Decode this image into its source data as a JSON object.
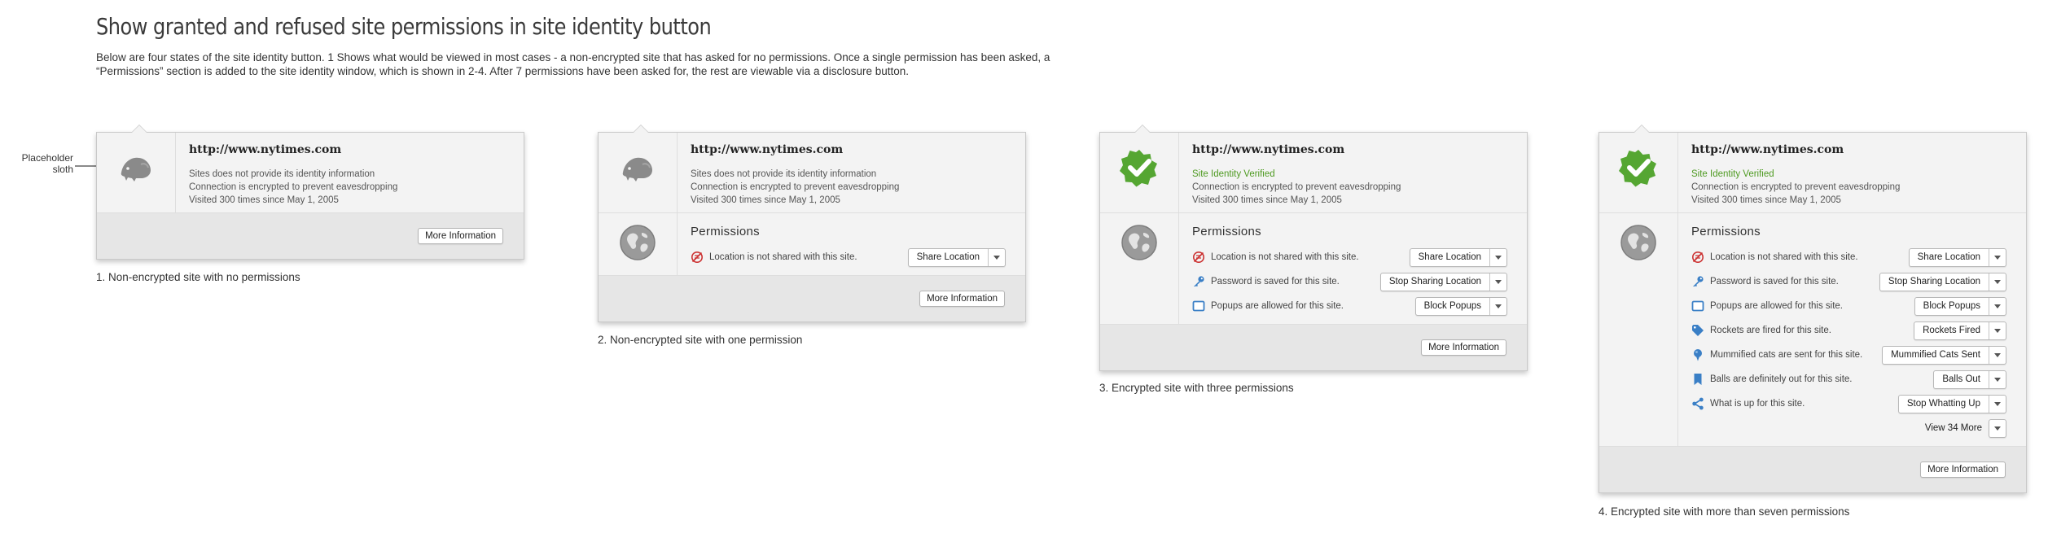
{
  "page": {
    "title": "Show granted and refused site permissions in site identity button",
    "description": "Below are four states of the site identity button.  1 Shows what would be viewed in most cases - a non-encrypted site that has asked for no permissions.  Once a single permission has been asked, a “Permissions” section is added to the site identity window, which is shown in 2-4.  After 7 permissions have been asked for, the rest are viewable via a disclosure button.",
    "annotation": "Placeholder sloth"
  },
  "colors": {
    "verified_green": "#4e9a21",
    "badge_green": "#55a632",
    "icon_blue": "#3a7fc6",
    "refused_red": "#cc3333"
  },
  "identity": {
    "url": "http://www.nytimes.com",
    "unverified": "Sites does not provide its identity information",
    "verified": "Site Identity Verified",
    "encrypted": "Connection is encrypted to prevent eavesdropping",
    "visited": "Visited 300 times since May 1, 2005"
  },
  "permissions_title": "Permissions",
  "more_info_label": "More Information",
  "view_more_label": "View 34 More",
  "permissions": [
    {
      "icon": "location-refused-icon",
      "text": "Location is not shared with this site.",
      "button": "Share Location"
    },
    {
      "icon": "key-icon",
      "text": "Password is saved for this site.",
      "button": "Stop Sharing Location"
    },
    {
      "icon": "popup-icon",
      "text": "Popups are allowed for this site.",
      "button": "Block Popups"
    },
    {
      "icon": "tag-icon",
      "text": "Rockets are fired for this site.",
      "button": "Rockets Fired"
    },
    {
      "icon": "pin-icon",
      "text": "Mummified cats are sent for this site.",
      "button": "Mummified Cats Sent"
    },
    {
      "icon": "bookmark-icon",
      "text": "Balls are definitely out for this site.",
      "button": "Balls Out"
    },
    {
      "icon": "share-icon",
      "text": "What is up for this site.",
      "button": "Stop Whatting Up"
    }
  ],
  "captions": [
    "1. Non-encrypted site with no permissions",
    "2. Non-encrypted site with one permission",
    "3. Encrypted site with three permissions",
    "4. Encrypted site with more than seven permissions"
  ]
}
